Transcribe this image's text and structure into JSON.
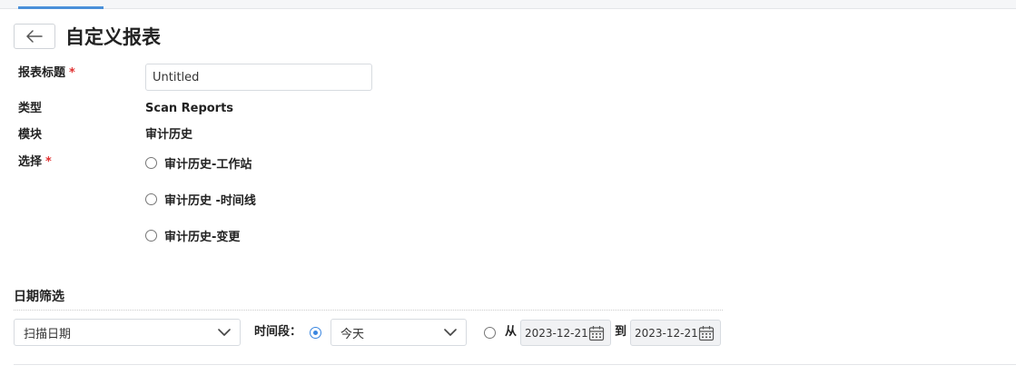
{
  "page": {
    "title": "自定义报表",
    "back_icon": "arrow-left-icon"
  },
  "form": {
    "title_label": "报表标题",
    "required_mark": "*",
    "title_value": "Untitled",
    "type_label": "类型",
    "type_value": "Scan Reports",
    "module_label": "模块",
    "module_value": "审计历史",
    "select_label": "选择",
    "options": [
      {
        "label": "审计历史-工作站",
        "selected": false
      },
      {
        "label": "审计历史 -时间线",
        "selected": false
      },
      {
        "label": "审计历史-变更",
        "selected": false
      }
    ]
  },
  "date_filter": {
    "section_title": "日期筛选",
    "date_field": "扫描日期",
    "period_label": "时间段：",
    "period_selected": true,
    "period_value": "今天",
    "range_selected": false,
    "from_label": "从",
    "from_date": "2023-12-21",
    "to_label": "到",
    "to_date": "2023-12-21"
  },
  "colors": {
    "accent": "#3a86e0",
    "required": "#e03131"
  }
}
